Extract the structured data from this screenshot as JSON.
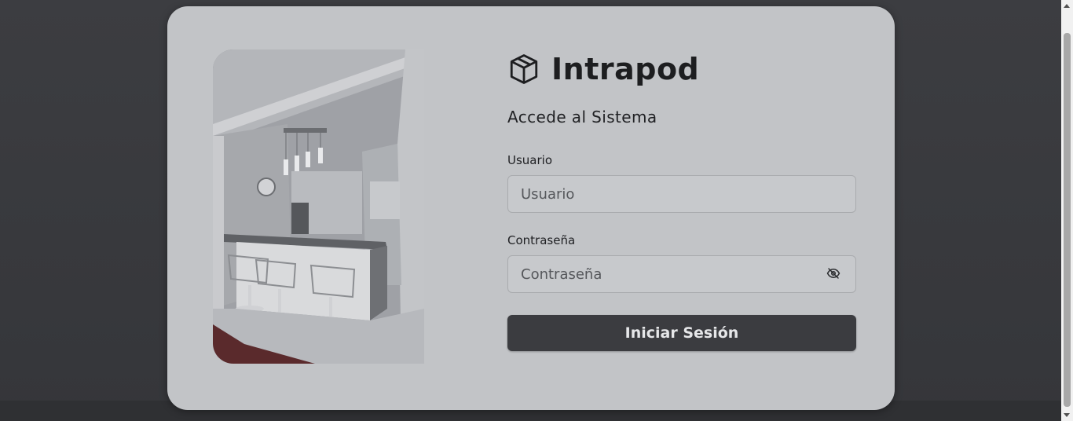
{
  "brand": {
    "name": "Intrapod",
    "icon": "box-icon"
  },
  "login": {
    "subtitle": "Accede al Sistema",
    "username_label": "Usuario",
    "username_placeholder": "Usuario",
    "password_label": "Contraseña",
    "password_placeholder": "Contraseña",
    "toggle_icon": "eye-off-icon",
    "submit_label": "Iniciar Sesión"
  },
  "colors": {
    "card_bg": "#c2c4c7",
    "page_bg": "#3a3b3f",
    "button_bg": "#3b3c40",
    "button_text": "#e6e7e9"
  }
}
